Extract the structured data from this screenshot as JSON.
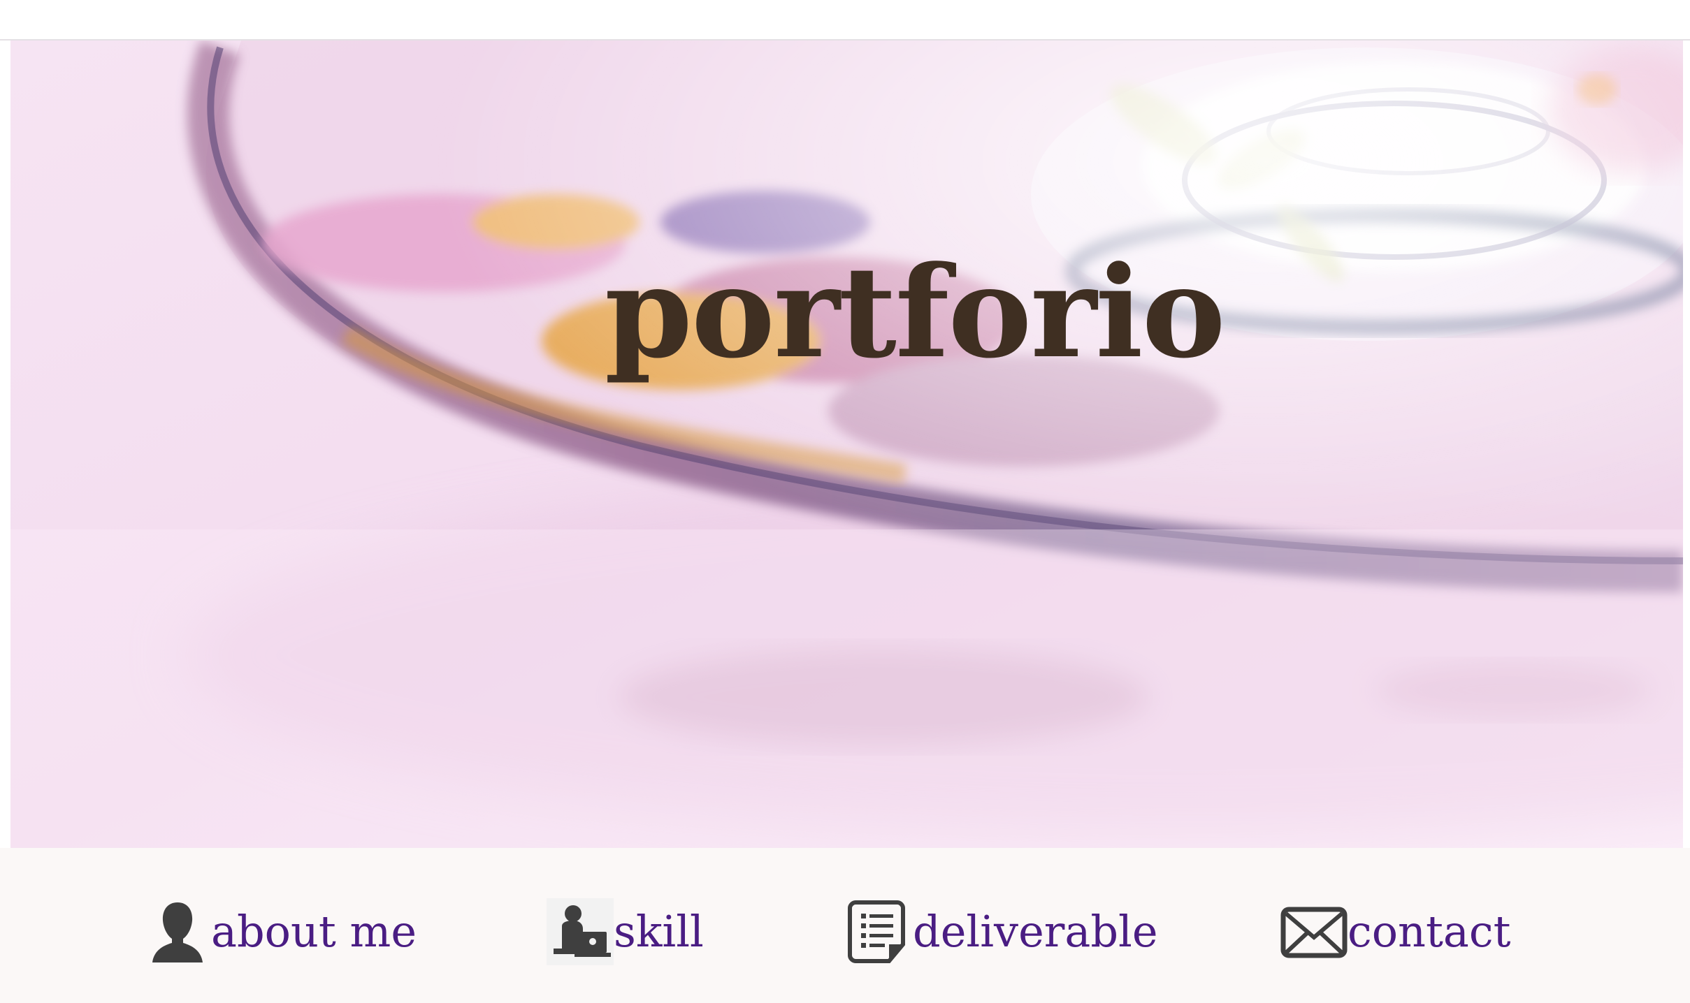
{
  "hero": {
    "title": "portforio"
  },
  "nav": {
    "items": [
      {
        "label": "about me",
        "icon": "person-silhouette-icon"
      },
      {
        "label": "skill",
        "icon": "person-at-laptop-icon"
      },
      {
        "label": "deliverable",
        "icon": "document-list-icon"
      },
      {
        "label": "contact",
        "icon": "envelope-icon"
      }
    ]
  },
  "colors": {
    "title": "#3f2f22",
    "nav_link": "#4a1d83",
    "nav_background": "#fbf8f7",
    "hero_tint": "#f8e9f6",
    "icon": "#3f3f3f"
  }
}
